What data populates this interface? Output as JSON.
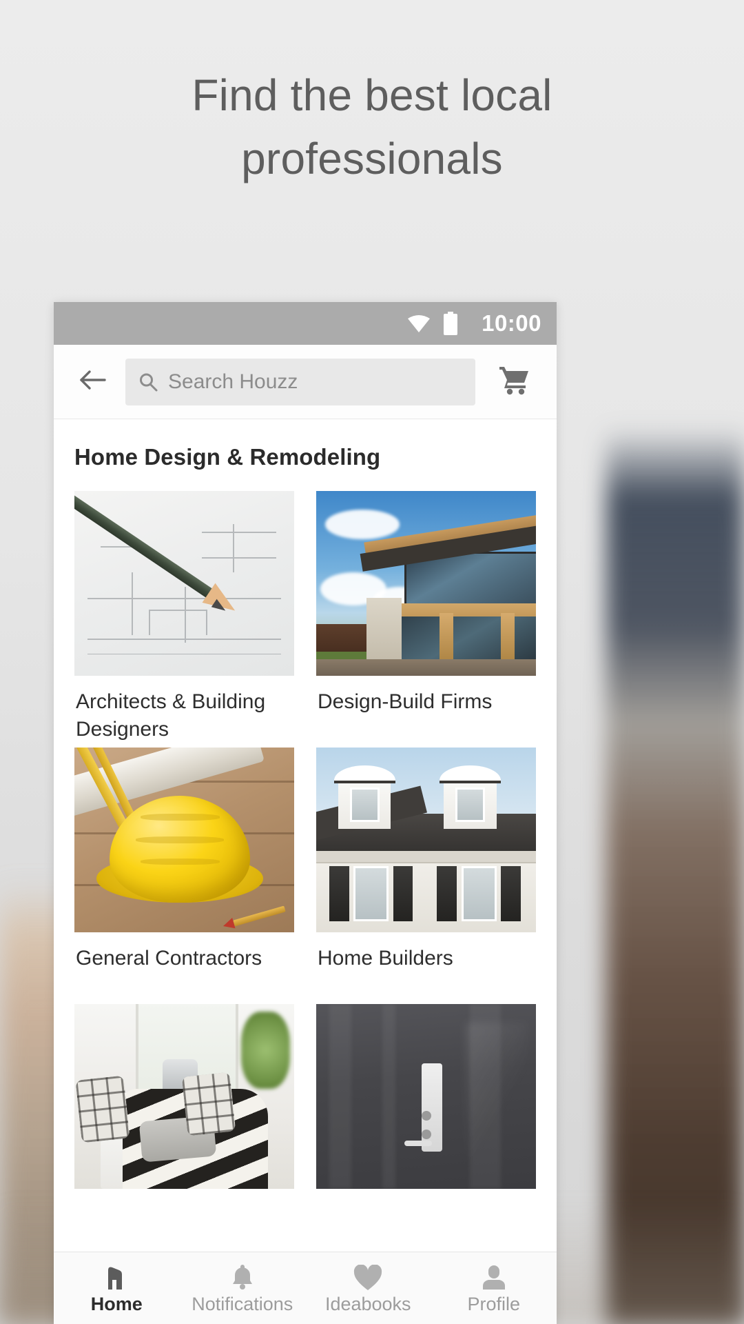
{
  "page": {
    "headline": "Find the best local professionals"
  },
  "statusbar": {
    "time": "10:00",
    "wifi_icon": "wifi-icon",
    "battery_icon": "battery-icon"
  },
  "appbar": {
    "back_icon": "back-arrow-icon",
    "search_placeholder": "Search Houzz",
    "search_value": "",
    "search_icon": "search-icon",
    "cart_icon": "shopping-cart-icon"
  },
  "main": {
    "section_title": "Home Design & Remodeling",
    "categories": [
      {
        "label": "Architects & Building Designers",
        "image": "blueprint-with-pencil"
      },
      {
        "label": "Design-Build Firms",
        "image": "modern-wood-glass-house"
      },
      {
        "label": "General Contractors",
        "image": "yellow-hard-hat-on-blueprints"
      },
      {
        "label": "Home Builders",
        "image": "white-colonial-house-with-dormers"
      },
      {
        "label": "",
        "image": "living-room-striped-throw"
      },
      {
        "label": "",
        "image": "dark-bathroom-shower-panel"
      }
    ]
  },
  "bottomnav": {
    "items": [
      {
        "label": "Home",
        "icon": "house-icon",
        "active": true
      },
      {
        "label": "Notifications",
        "icon": "bell-icon",
        "active": false
      },
      {
        "label": "Ideabooks",
        "icon": "heart-icon",
        "active": false
      },
      {
        "label": "Profile",
        "icon": "person-icon",
        "active": false
      }
    ]
  },
  "colors": {
    "statusbar_bg": "#ababab",
    "headline_text": "#5e5e5e",
    "search_field_bg": "#e8e8e8",
    "nav_active": "#2c2c2c",
    "nav_inactive": "#9c9c9c"
  }
}
